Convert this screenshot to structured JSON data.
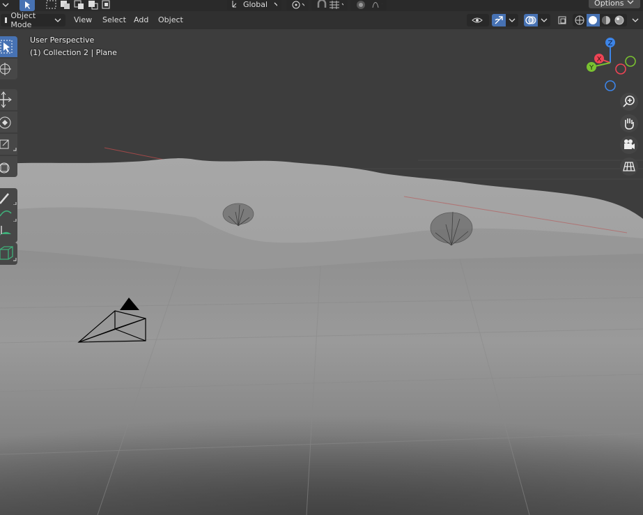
{
  "toolbar": {
    "orientation_label": "Global",
    "options_label": "Options"
  },
  "header": {
    "mode_label": "Object Mode",
    "menus": [
      "View",
      "Select",
      "Add",
      "Object"
    ]
  },
  "viewport": {
    "perspective_label": "User Perspective",
    "collection_label": "(1) Collection 2 | Plane"
  },
  "gizmo": {
    "axis_labels": {
      "x": "X",
      "y": "Y",
      "z": "Z"
    },
    "axis_colors": {
      "x": "#ee4455",
      "y": "#7ac231",
      "z": "#3d85e8"
    }
  },
  "left_tools": [
    "select-box-icon",
    "cursor-icon",
    "move-icon",
    "rotate-icon",
    "scale-icon",
    "transform-icon",
    "annotate-icon",
    "measure-icon",
    "add-cube-icon"
  ],
  "nav_buttons": [
    "zoom-icon",
    "hand-pan-icon",
    "camera-view-icon",
    "grid-ortho-icon"
  ],
  "colors": {
    "accent": "#4772b3",
    "header_bg": "#303030",
    "grid_bg": "#3d3d3d"
  }
}
